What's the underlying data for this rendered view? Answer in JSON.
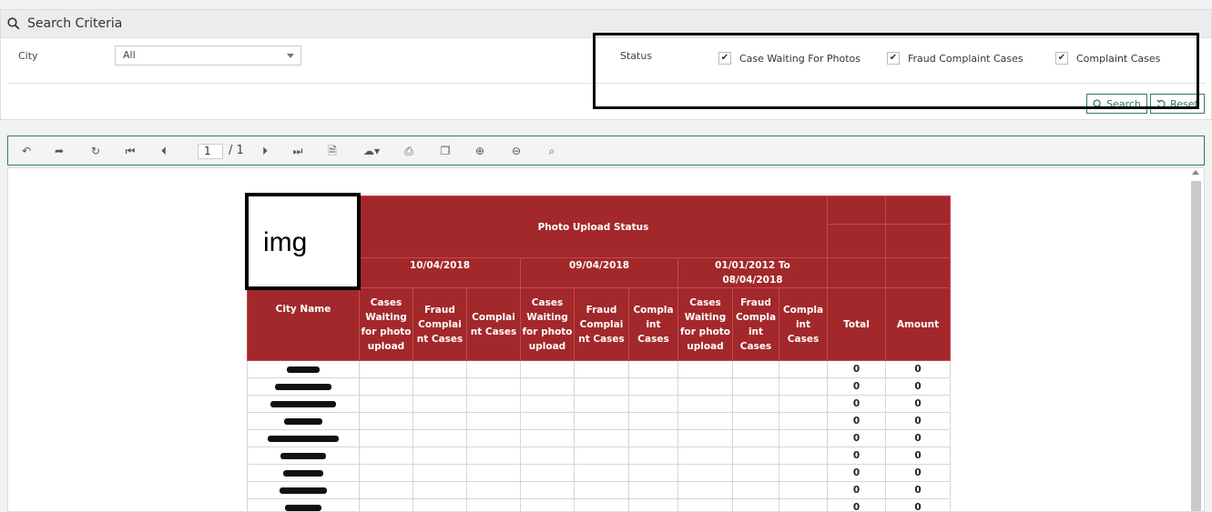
{
  "criteria": {
    "title": "Search Criteria",
    "city_label": "City",
    "city_value": "All",
    "status_label": "Status",
    "checkboxes": [
      {
        "label": "Case Waiting For Photos",
        "checked": true
      },
      {
        "label": "Fraud Complaint Cases",
        "checked": true
      },
      {
        "label": "Complaint Cases",
        "checked": true
      }
    ],
    "search_label": "Search",
    "reset_label": "Reset"
  },
  "toolbar": {
    "page_current": "1",
    "page_total": "/ 1",
    "icons": [
      "undo-icon",
      "redo-icon",
      "refresh-icon",
      "first-page-icon",
      "prev-page-icon",
      "next-page-icon",
      "last-page-icon",
      "document-icon",
      "export-icon",
      "print-icon",
      "layout-icon",
      "zoom-in-icon",
      "zoom-out-icon",
      "search-icon"
    ]
  },
  "report": {
    "image_placeholder": "img",
    "title": "Photo Upload Status",
    "periods": [
      "10/04/2018",
      "09/04/2018",
      "01/01/2012 To 08/04/2018"
    ],
    "city_header": "City Name",
    "sub_headers": [
      "Cases Waiting for photo upload",
      "Fraud Complai nt Cases",
      "Complai nt Cases",
      "Cases Waiting for photo upload",
      "Fraud Complai nt Cases",
      "Compla int Cases",
      "Cases Waiting for photo upload",
      "Fraud Compla int Cases",
      "Compla int Cases"
    ],
    "total_header": "Total",
    "amount_header": "Amount",
    "rows": [
      {
        "total": "0",
        "amount": "0"
      },
      {
        "total": "0",
        "amount": "0"
      },
      {
        "total": "0",
        "amount": "0"
      },
      {
        "total": "0",
        "amount": "0"
      },
      {
        "total": "0",
        "amount": "0"
      },
      {
        "total": "0",
        "amount": "0"
      },
      {
        "total": "0",
        "amount": "0"
      },
      {
        "total": "0",
        "amount": "0"
      },
      {
        "total": "0",
        "amount": "0"
      }
    ]
  },
  "colors": {
    "accent_green": "#2e7d5b",
    "header_red": "#a3282b"
  }
}
